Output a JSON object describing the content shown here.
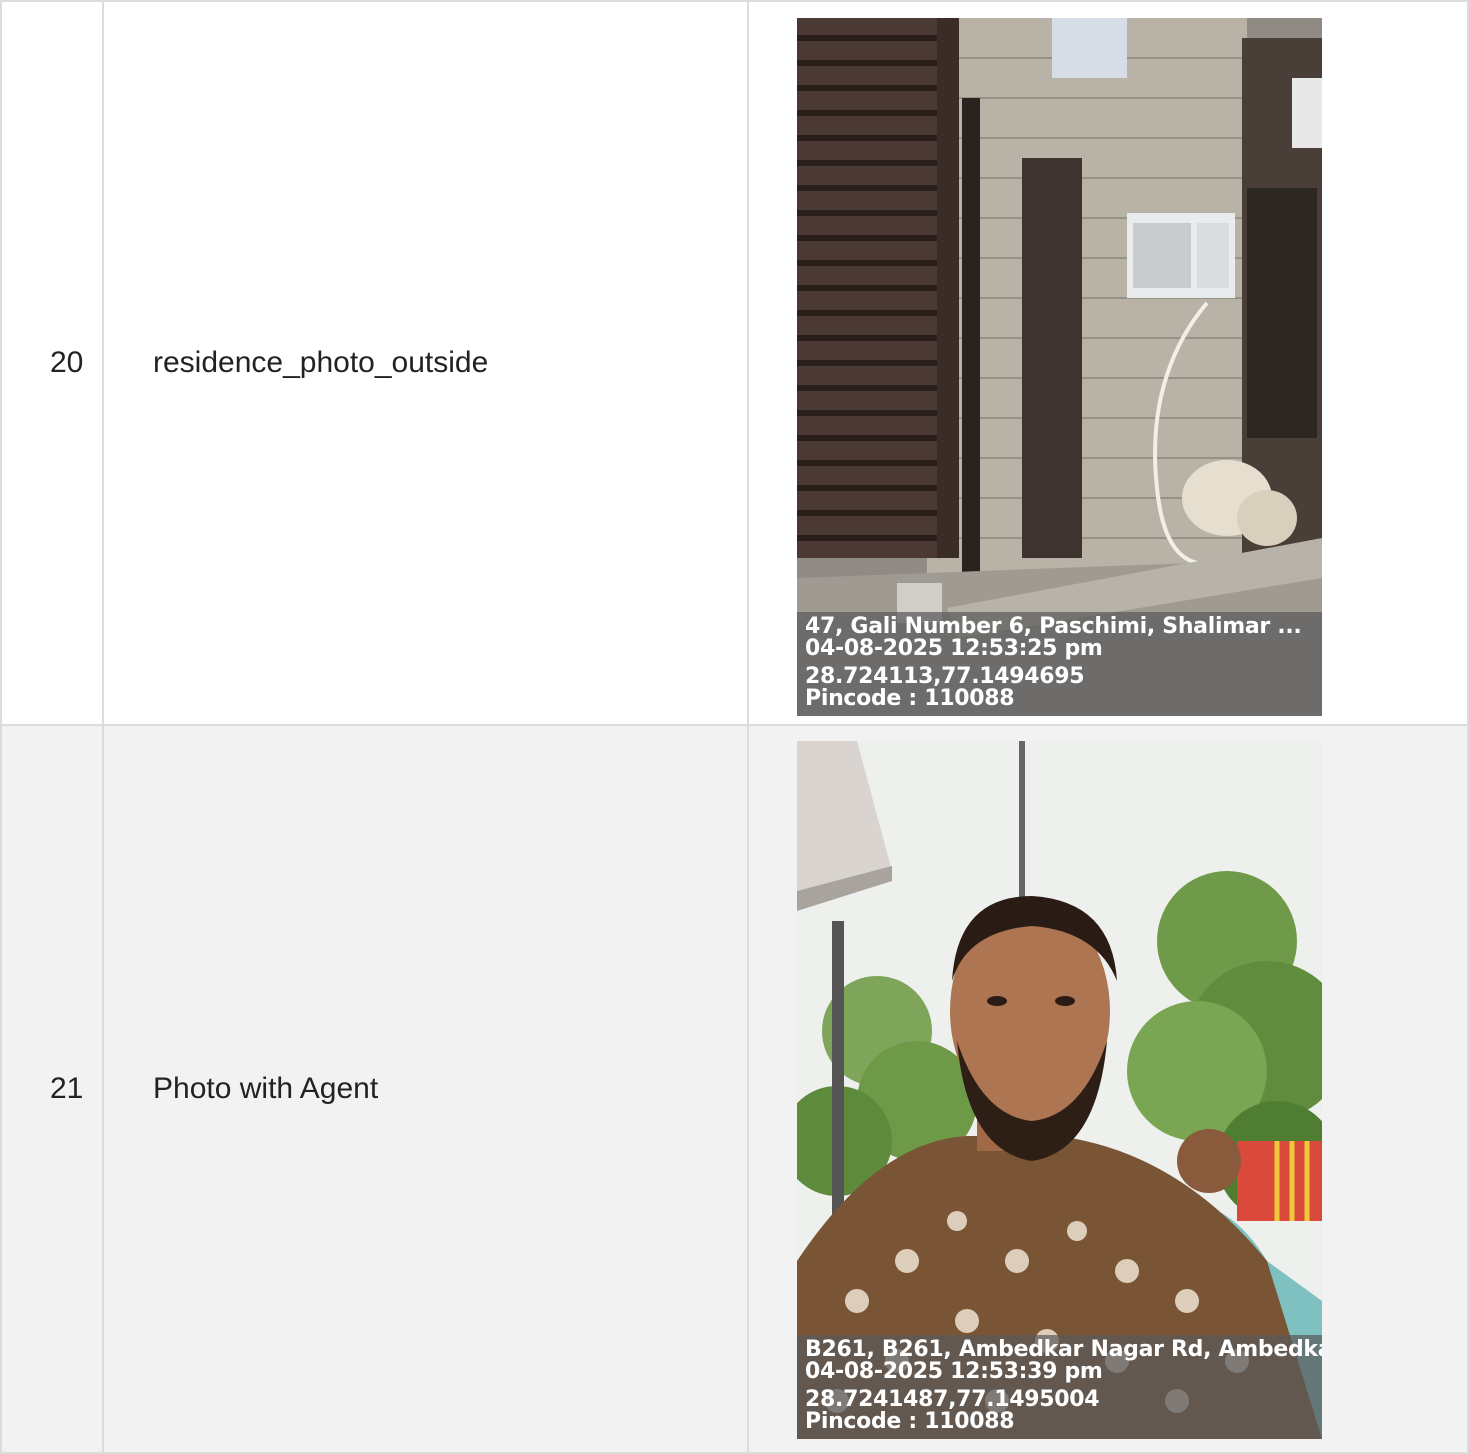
{
  "rows": [
    {
      "number": "20",
      "label": "residence_photo_outside",
      "photo": {
        "address": "47, Gali Number 6, Paschimi, Shalimar ...",
        "datetime": "04-08-2025 12:53:25 pm",
        "coordinates": "28.724113,77.1494695",
        "pincode": "Pincode : 110088"
      }
    },
    {
      "number": "21",
      "label": "Photo with Agent",
      "photo": {
        "address": "B261, B261, Ambedkar Nagar Rd, Ambedka",
        "datetime": "04-08-2025 12:53:39 pm",
        "coordinates": "28.7241487,77.1495004",
        "pincode": "Pincode : 110088"
      }
    }
  ]
}
